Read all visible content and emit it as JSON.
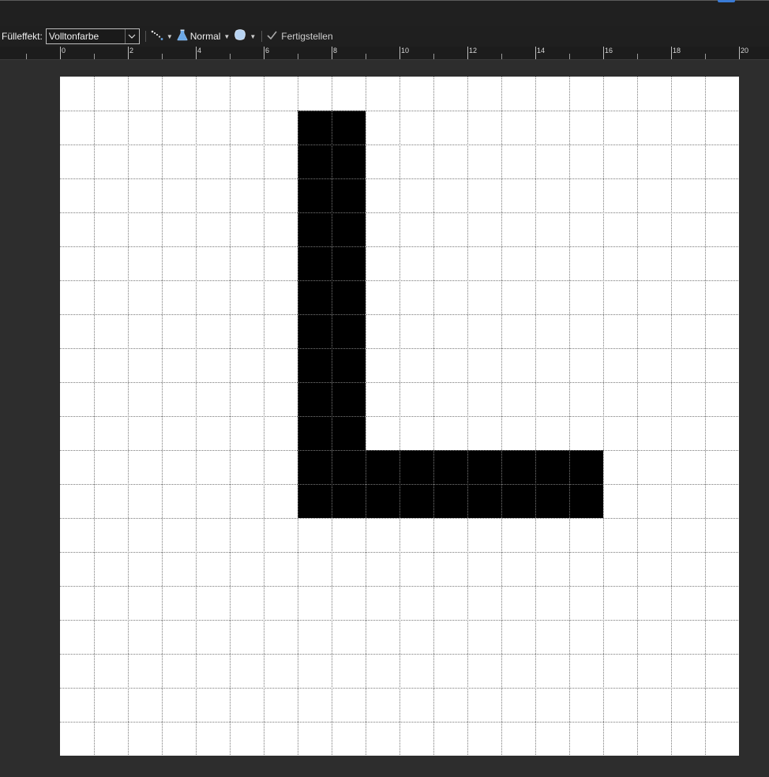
{
  "toolbar": {
    "fill_label": "Fülleffekt:",
    "fill_value": "Volltonfarbe",
    "blend_label": "Normal",
    "finish_label": "Fertigstellen",
    "icons": [
      "brush-stroke-icon",
      "chevron-down-icon",
      "flask-icon",
      "shape-blob-icon",
      "checkmark-icon"
    ]
  },
  "ruler": {
    "labels": [
      "0",
      "2",
      "4",
      "6",
      "8",
      "10",
      "12",
      "14",
      "16",
      "18",
      "20"
    ]
  },
  "canvas": {
    "grid_cols": 20,
    "grid_rows": 20,
    "paper_color": "#ffffff",
    "ink_color": "#000000",
    "grid_color": "#7a7a7a",
    "filled_cells": [
      [
        7,
        1
      ],
      [
        8,
        1
      ],
      [
        7,
        2
      ],
      [
        8,
        2
      ],
      [
        7,
        3
      ],
      [
        8,
        3
      ],
      [
        7,
        4
      ],
      [
        8,
        4
      ],
      [
        7,
        5
      ],
      [
        8,
        5
      ],
      [
        7,
        6
      ],
      [
        8,
        6
      ],
      [
        7,
        7
      ],
      [
        8,
        7
      ],
      [
        7,
        8
      ],
      [
        8,
        8
      ],
      [
        7,
        9
      ],
      [
        8,
        9
      ],
      [
        7,
        10
      ],
      [
        8,
        10
      ],
      [
        7,
        11
      ],
      [
        8,
        11
      ],
      [
        9,
        11
      ],
      [
        10,
        11
      ],
      [
        11,
        11
      ],
      [
        12,
        11
      ],
      [
        13,
        11
      ],
      [
        14,
        11
      ],
      [
        15,
        11
      ],
      [
        7,
        12
      ],
      [
        8,
        12
      ],
      [
        9,
        12
      ],
      [
        10,
        12
      ],
      [
        11,
        12
      ],
      [
        12,
        12
      ],
      [
        13,
        12
      ],
      [
        14,
        12
      ],
      [
        15,
        12
      ]
    ]
  },
  "colors": {
    "accent": "#3a7bd5",
    "flask": "#6aa8e8",
    "blob": "#b7d3f2"
  }
}
